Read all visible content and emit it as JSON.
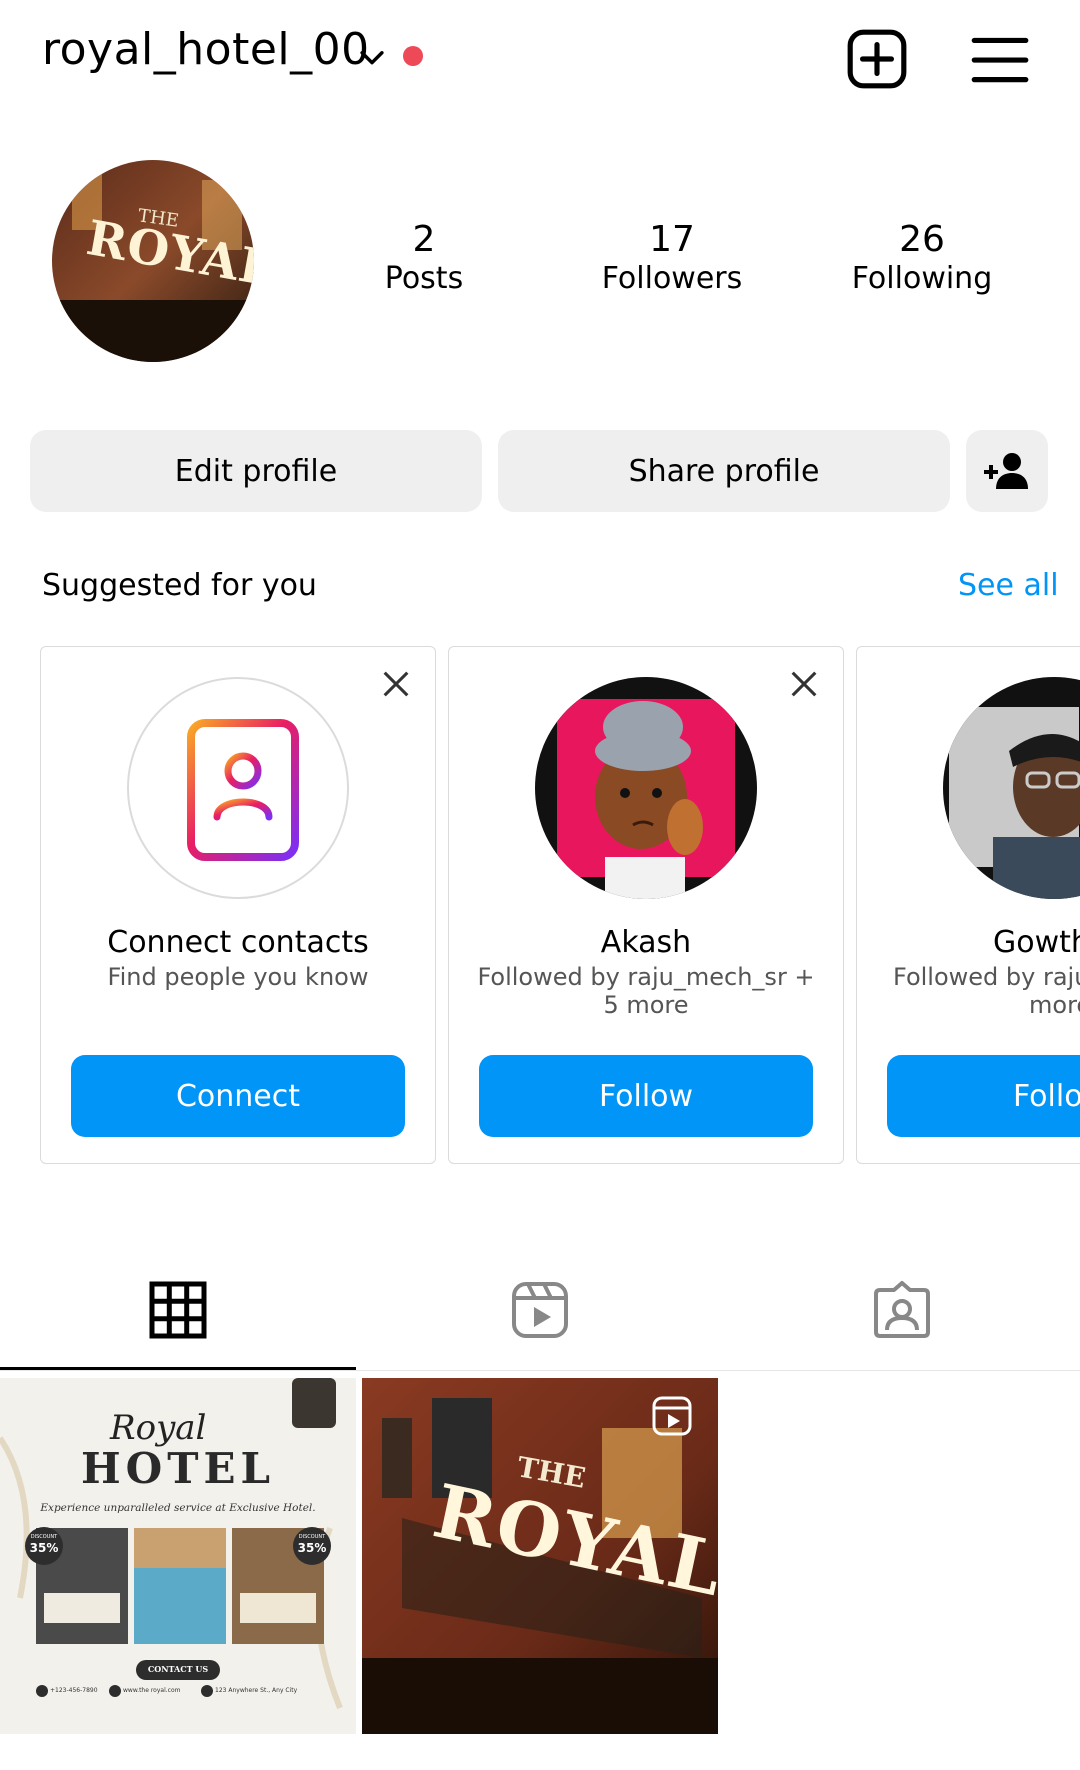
{
  "header": {
    "username": "royal_hotel_00",
    "notification_color": "#ed4956"
  },
  "profile": {
    "avatar_text": "ROYAL",
    "avatar_small": "THE",
    "stats": [
      {
        "value": "2",
        "label": "Posts"
      },
      {
        "value": "17",
        "label": "Followers"
      },
      {
        "value": "26",
        "label": "Following"
      }
    ]
  },
  "actions": {
    "edit": "Edit profile",
    "share": "Share profile"
  },
  "suggested": {
    "title": "Suggested for you",
    "see_all": "See all",
    "cards": [
      {
        "name": "Connect contacts",
        "sub": "Find people you know",
        "button": "Connect"
      },
      {
        "name": "Akash",
        "sub": "Followed by raju_mech_sr + 5 more",
        "button": "Follow"
      },
      {
        "name": "Gowth",
        "sub": "Followed by raju_",
        "sub2": "more",
        "button": "Follo"
      }
    ]
  },
  "posts": [
    {
      "script": "Royal",
      "title": "HOTEL",
      "tagline": "Experience unparalleled service at Exclusive Hotel.",
      "discount_label": "DISCOUNT",
      "discount_value": "35%",
      "cta": "CONTACT US",
      "phone": "+123-456-7890",
      "web": "www.the royal.com",
      "address": "123 Anywhere St., Any City"
    },
    {
      "sign_small": "THE",
      "sign_big": "ROYAL"
    }
  ],
  "colors": {
    "accent": "#0095f6",
    "button_bg": "#efefef"
  }
}
